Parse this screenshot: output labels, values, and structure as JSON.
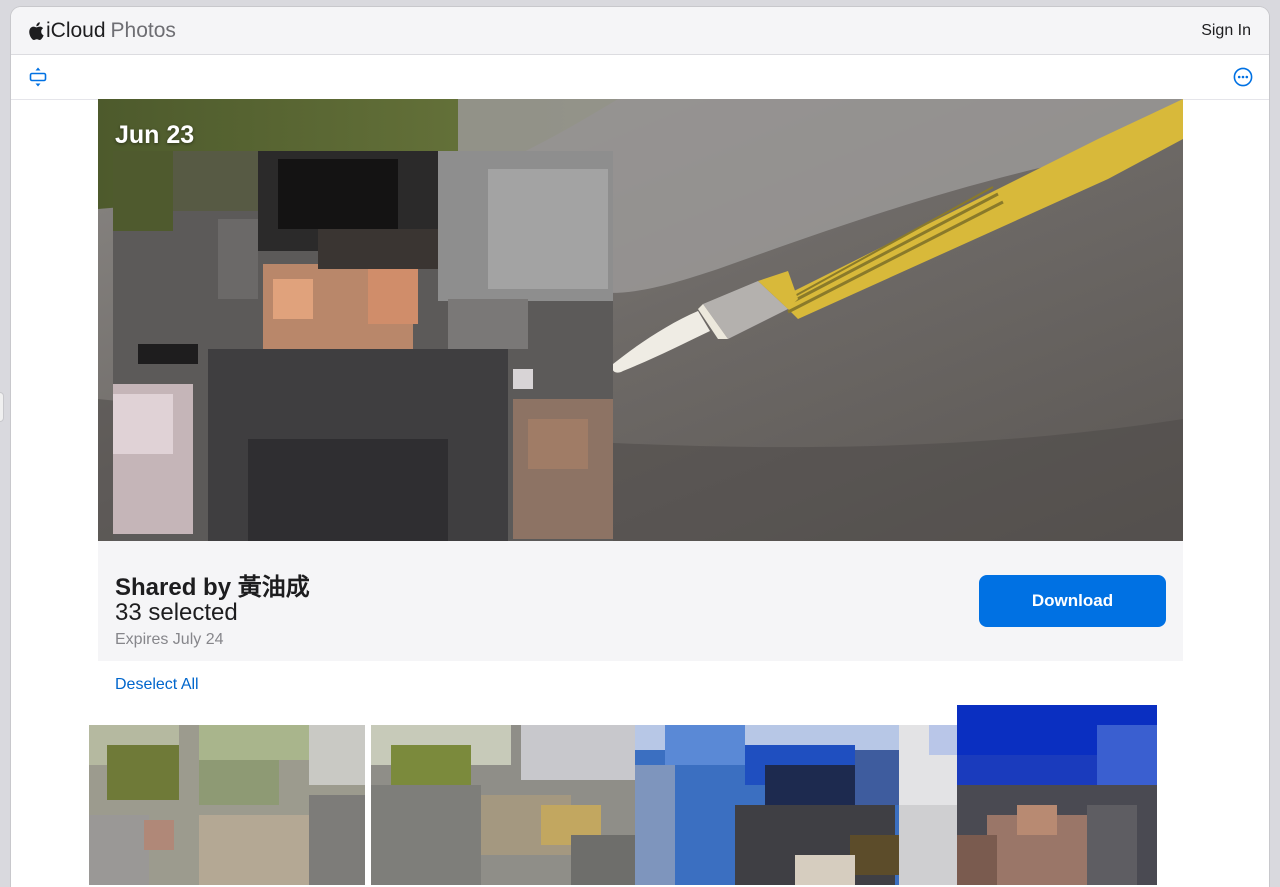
{
  "header": {
    "brand": "iCloud",
    "brand_sub": "Photos",
    "sign_in": "Sign In"
  },
  "toolbar": {
    "left_icon": "resize-icon",
    "right_icon": "more-icon"
  },
  "hero": {
    "date": "Jun 23"
  },
  "share": {
    "shared_by": "Shared by 黃油成",
    "selected": "33 selected",
    "expires": "Expires July 24",
    "download_label": "Download"
  },
  "actions": {
    "deselect_all": "Deselect All"
  },
  "colors": {
    "accent": "#0071e3",
    "link": "#0066cc",
    "panel": "#f5f5f7"
  }
}
